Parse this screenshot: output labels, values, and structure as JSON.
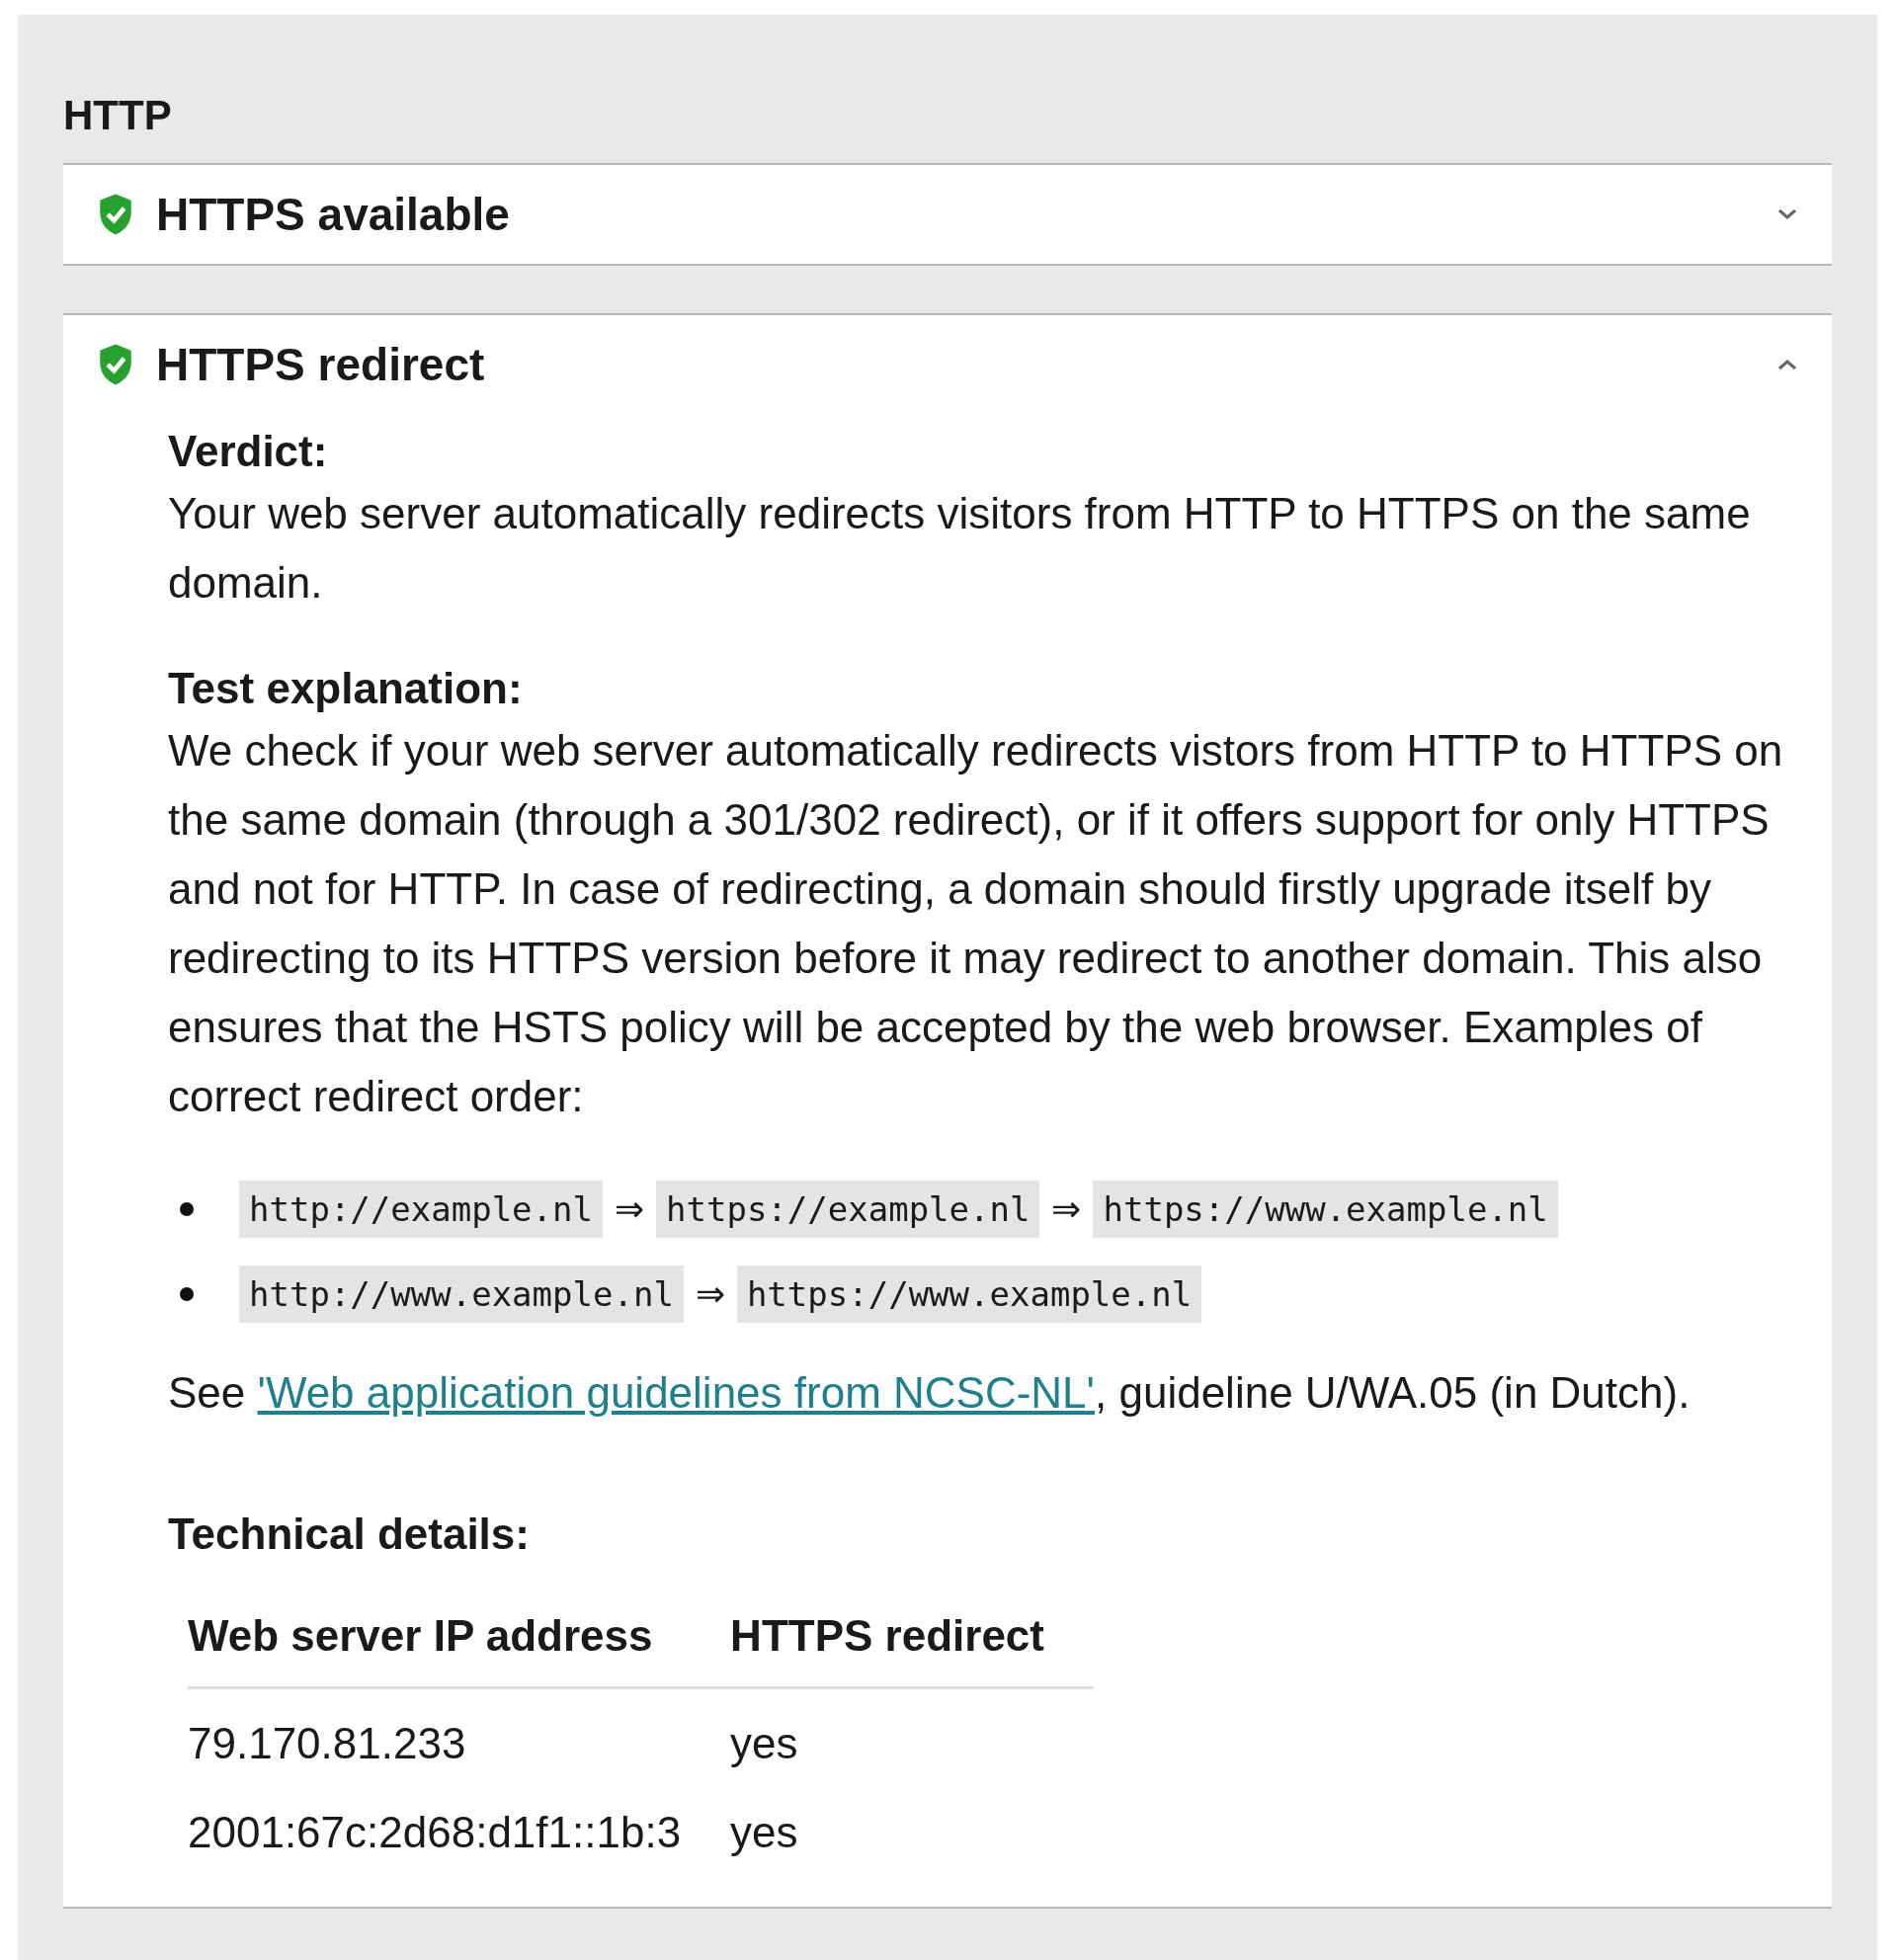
{
  "section_title": "HTTP",
  "tests": [
    {
      "title": "HTTPS available",
      "passed": true,
      "expanded": false
    },
    {
      "title": "HTTPS redirect",
      "passed": true,
      "expanded": true,
      "verdict_label": "Verdict:",
      "verdict": "Your web server automatically redirects visitors from HTTP to HTTPS on the same domain.",
      "explanation_label": "Test explanation:",
      "explanation": "We check if your web server automatically redirects vistors from HTTP to HTTPS on the same domain (through a 301/302 redirect), or if it offers support for only HTTPS and not for HTTP. In case of redirecting, a domain should firstly upgrade itself by redirecting to its HTTPS version before it may redirect to another domain. This also ensures that the HSTS policy will be accepted by the web browser. Examples of correct redirect order:",
      "examples": [
        [
          {
            "kind": "code",
            "text": "http://example.nl"
          },
          {
            "kind": "arrow",
            "text": "⇒"
          },
          {
            "kind": "code",
            "text": "https://example.nl"
          },
          {
            "kind": "arrow",
            "text": "⇒"
          },
          {
            "kind": "code",
            "text": "https://www.example.nl"
          }
        ],
        [
          {
            "kind": "code",
            "text": "http://www.example.nl"
          },
          {
            "kind": "arrow",
            "text": "⇒"
          },
          {
            "kind": "code",
            "text": "https://www.example.nl"
          }
        ]
      ],
      "reference": {
        "before": "See ",
        "link": "'Web application guidelines from NCSC-NL'",
        "after": ", guideline U/WA.05 (in Dutch)."
      },
      "details_label": "Technical details:",
      "table": {
        "columns": [
          "Web server IP address",
          "HTTPS redirect"
        ],
        "rows": [
          [
            "79.170.81.233",
            "yes"
          ],
          [
            "2001:67c:2d68:d1f1::1b:3",
            "yes"
          ]
        ]
      }
    }
  ]
}
